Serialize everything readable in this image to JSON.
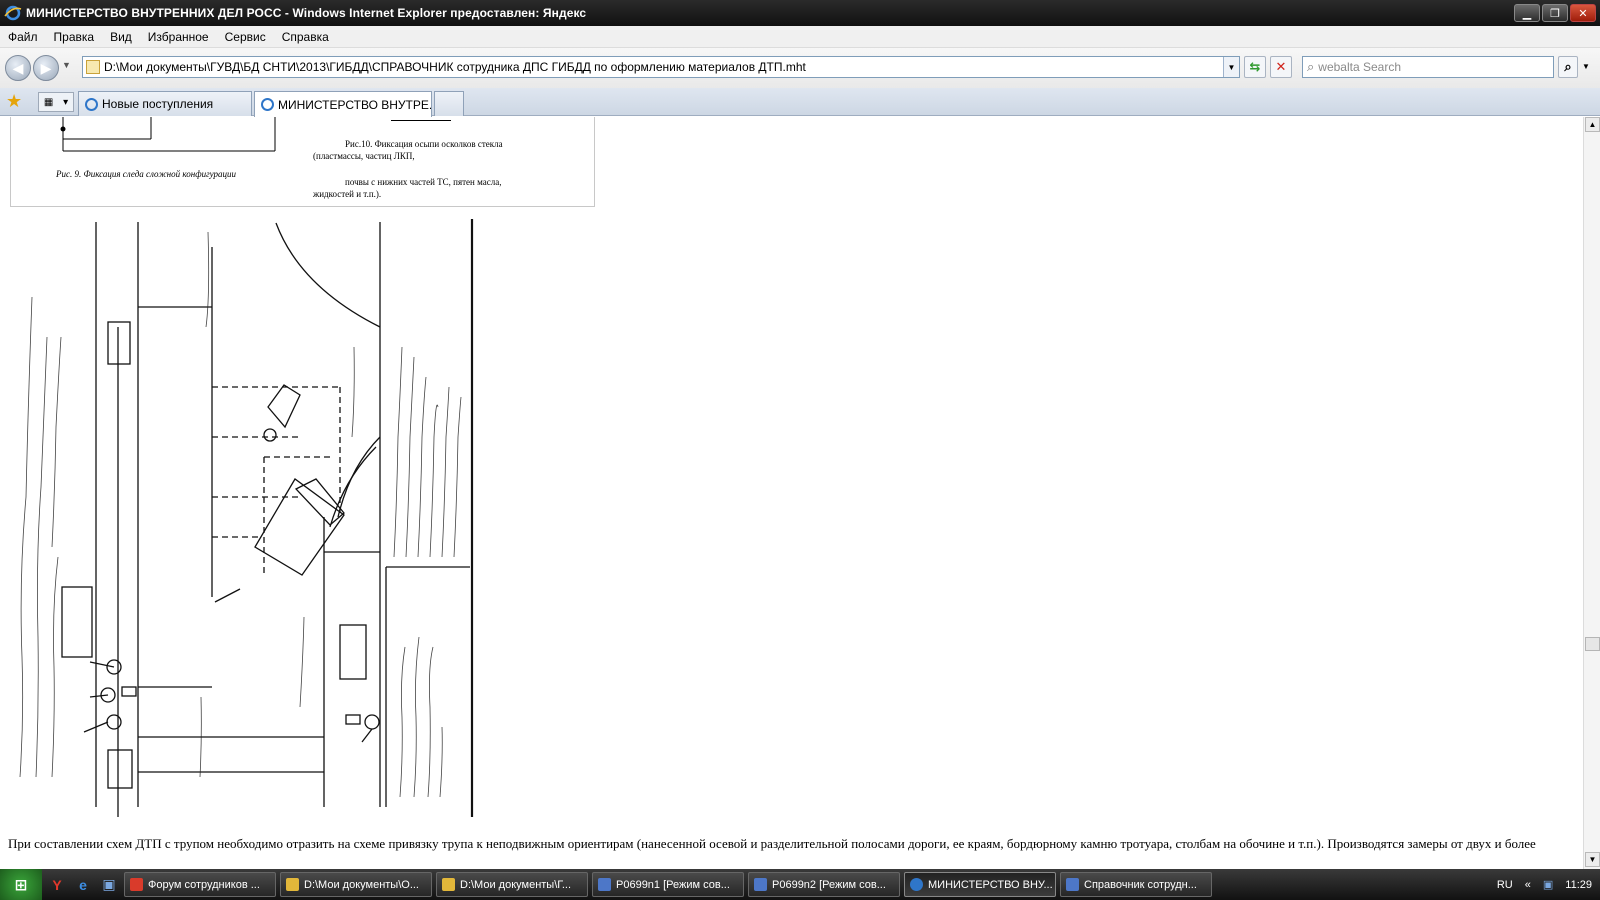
{
  "window": {
    "title": "МИНИСТЕРСТВО ВНУТРЕННИХ ДЕЛ РОСС - Windows Internet Explorer предоставлен: Яндекс",
    "minimize": "▁",
    "restore": "❐",
    "close": "✕"
  },
  "menu": {
    "file": "Файл",
    "edit": "Правка",
    "view": "Вид",
    "favorites": "Избранное",
    "tools": "Сервис",
    "help": "Справка"
  },
  "nav": {
    "back": "◀",
    "forward": "▶",
    "address": "D:\\Мои документы\\ГУВД\\БД СНТИ\\2013\\ГИБДД\\СПРАВОЧНИК сотрудника ДПС ГИБДД по оформлению материалов ДТП.mht",
    "refresh": "⇆",
    "stop": "✕",
    "search_placeholder": "webalta Search",
    "search_go": "⌕"
  },
  "tabs": [
    {
      "label": "Новые поступления"
    },
    {
      "label": "МИНИСТЕРСТВО ВНУТРЕ...",
      "active": true
    }
  ],
  "content": {
    "fig10_line1": "Рис.10. Фиксация осыпи осколков стекла",
    "fig10_line2": "(пластмассы, частиц ЛКП,",
    "fig10_line3": "почвы с нижних частей ТС, пятен масла,",
    "fig10_line4": "жидкостей и т.п.).",
    "fig9": "Рис. 9. Фиксация следа сложной конфигурации",
    "body_text": "При составлении схем ДТП с трупом необходимо отразить на схеме привязку трупа к неподвижным ориентирам (нанесенной осевой и разделительной полосами дороги, ее краям, бордюрному камню тротуара, столбам на обочине и т.п.). Производятся замеры от двух и более"
  },
  "taskbar": {
    "tasks": [
      {
        "label": "Форум сотрудников ...",
        "icon_color": "#d93b2b"
      },
      {
        "label": "D:\\Мои документы\\О...",
        "icon_color": "#e2b73a"
      },
      {
        "label": "D:\\Мои документы\\Г...",
        "icon_color": "#e2b73a"
      },
      {
        "label": "P0699n1 [Режим сов...",
        "icon_color": "#4d77c8"
      },
      {
        "label": "P0699n2 [Режим сов...",
        "icon_color": "#4d77c8"
      },
      {
        "label": "МИНИСТЕРСТВО ВНУ...",
        "icon_color": "#2f76c9",
        "active": true
      },
      {
        "label": "Справочник сотрудн...",
        "icon_color": "#4d77c8"
      }
    ],
    "lang": "RU",
    "time": "11:29"
  },
  "colors": {
    "titlebar": "#1a1a1a",
    "taskbar": "#222222",
    "ie_blue": "#2f76c9"
  }
}
